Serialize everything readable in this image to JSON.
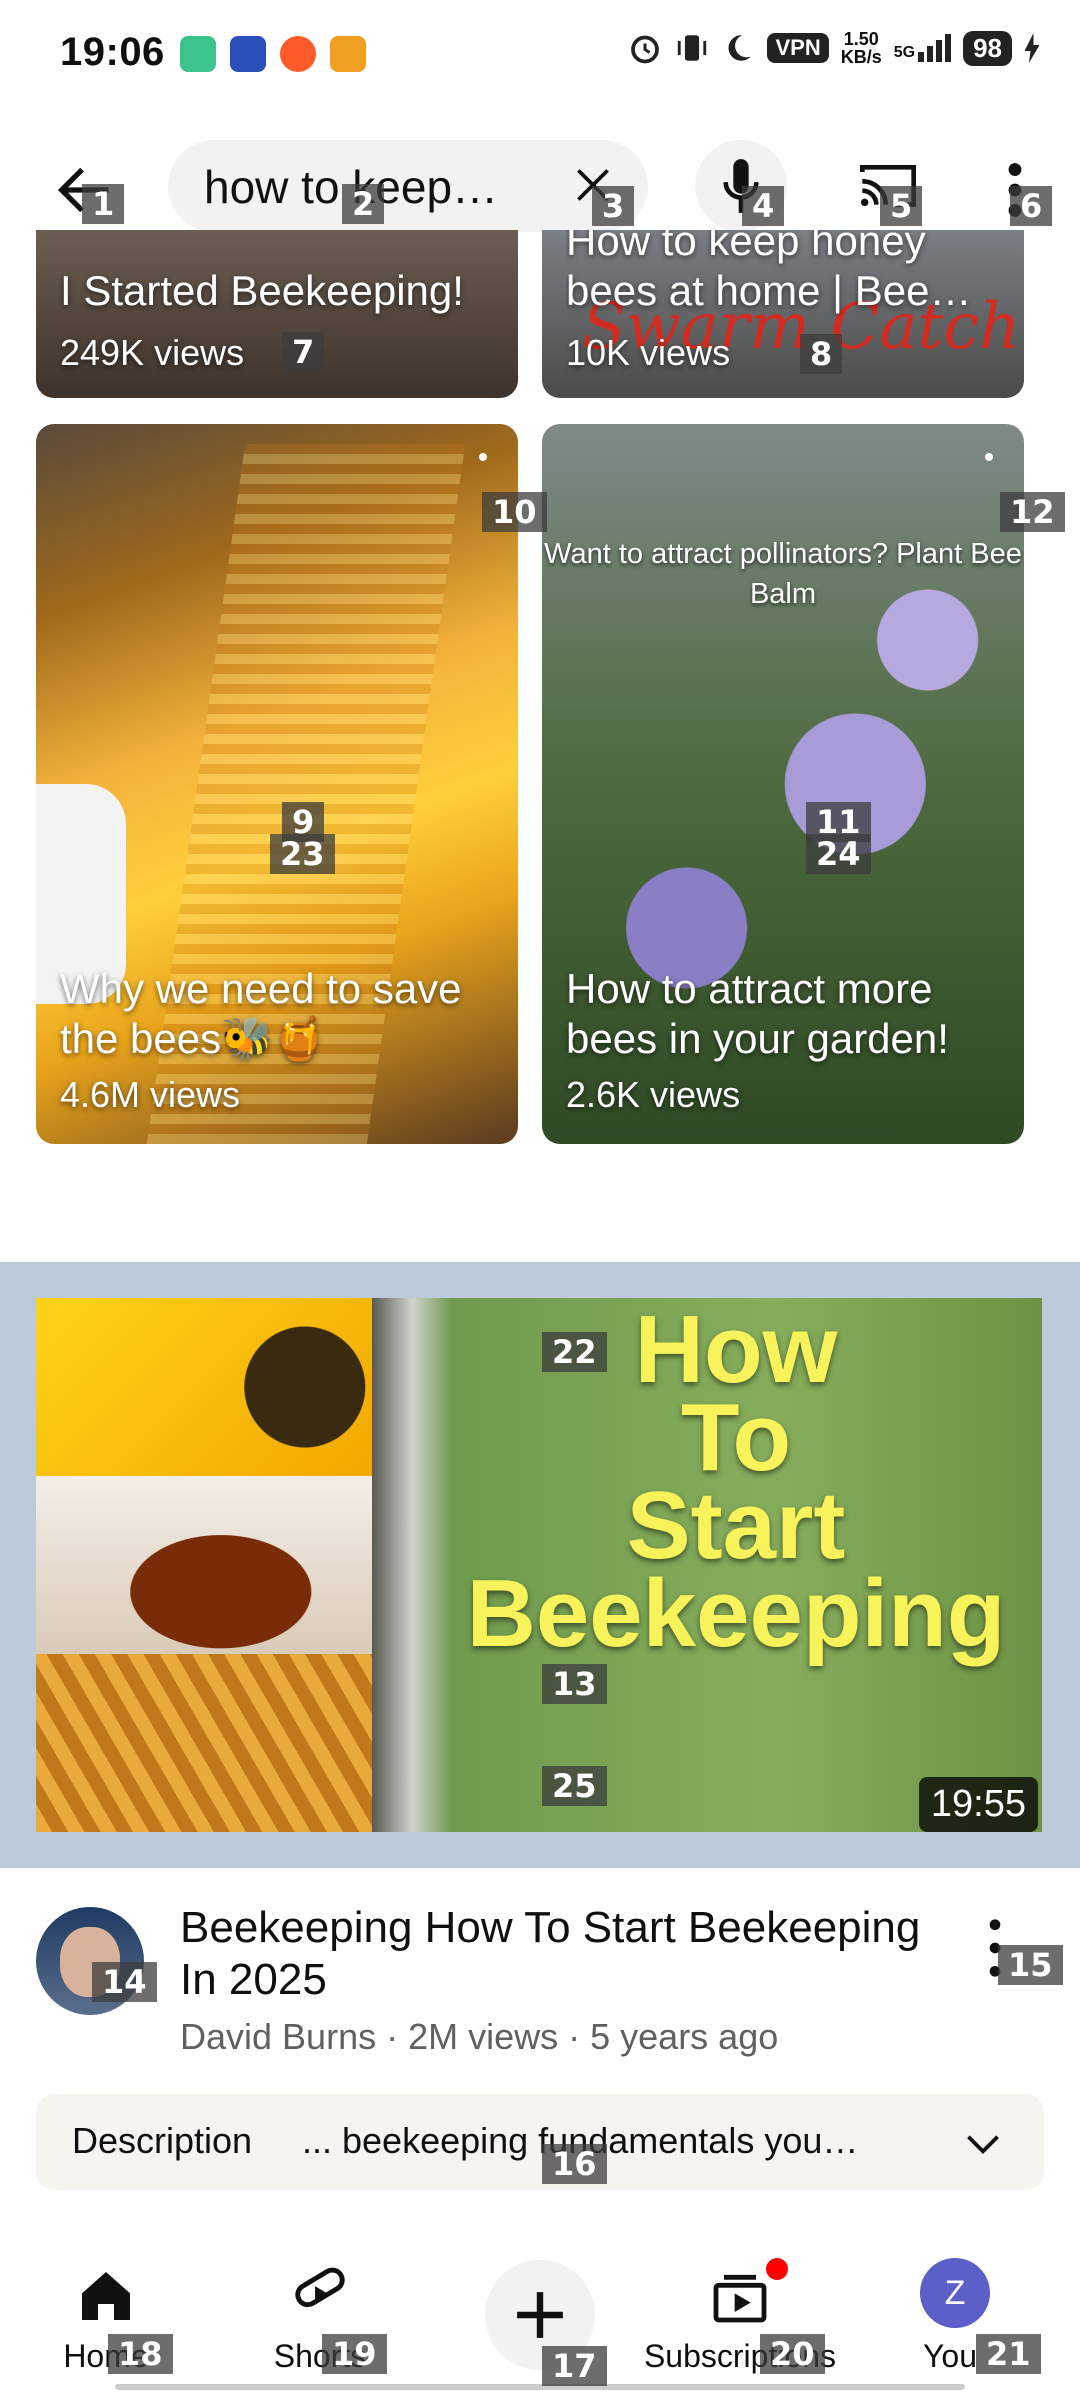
{
  "status_bar": {
    "time": "19:06",
    "vpn": "VPN",
    "speed_value": "1.50",
    "speed_unit": "KB/s",
    "network": "5G",
    "battery": "98"
  },
  "search": {
    "query": "how to keep…",
    "back_label": "Back",
    "clear_label": "Clear",
    "mic_label": "Voice search",
    "cast_label": "Cast",
    "more_label": "More"
  },
  "shorts": [
    {
      "title": "I Started Beekeeping!",
      "views": "249K views"
    },
    {
      "title": "How to keep honey bees at home | Bee…",
      "views": "10K views",
      "overlay": "Swarm Catching"
    },
    {
      "title": "Why we need to save the bees🐝🍯",
      "views": "4.6M views"
    },
    {
      "title": "How to attract more bees in your garden!",
      "views": "2.6K views",
      "overlay": "Want to attract pollinators? Plant Bee Balm"
    }
  ],
  "video": {
    "thumbnail_text": [
      "How",
      "To",
      "Start",
      "Beekeeping"
    ],
    "duration": "19:55",
    "title": "Beekeeping How To Start Beekeeping In 2025",
    "channel": "David Burns",
    "views": "2M views",
    "age": "5 years ago"
  },
  "description": {
    "label": "Description",
    "text": "... beekeeping fundamentals you…"
  },
  "nav": {
    "home": "Home",
    "shorts": "Shorts",
    "subscriptions": "Subscriptions",
    "you": "You",
    "you_initial": "Z"
  },
  "marks": [
    "1",
    "2",
    "3",
    "4",
    "5",
    "6",
    "7",
    "8",
    "9",
    "10",
    "11",
    "12",
    "13",
    "14",
    "15",
    "16",
    "17",
    "18",
    "19",
    "20",
    "21",
    "22",
    "23",
    "24",
    "25"
  ],
  "colors": {
    "accent_red": "#ff0000",
    "feature_bg": "#bccbdb",
    "avatar_you": "#5b5fc7"
  }
}
